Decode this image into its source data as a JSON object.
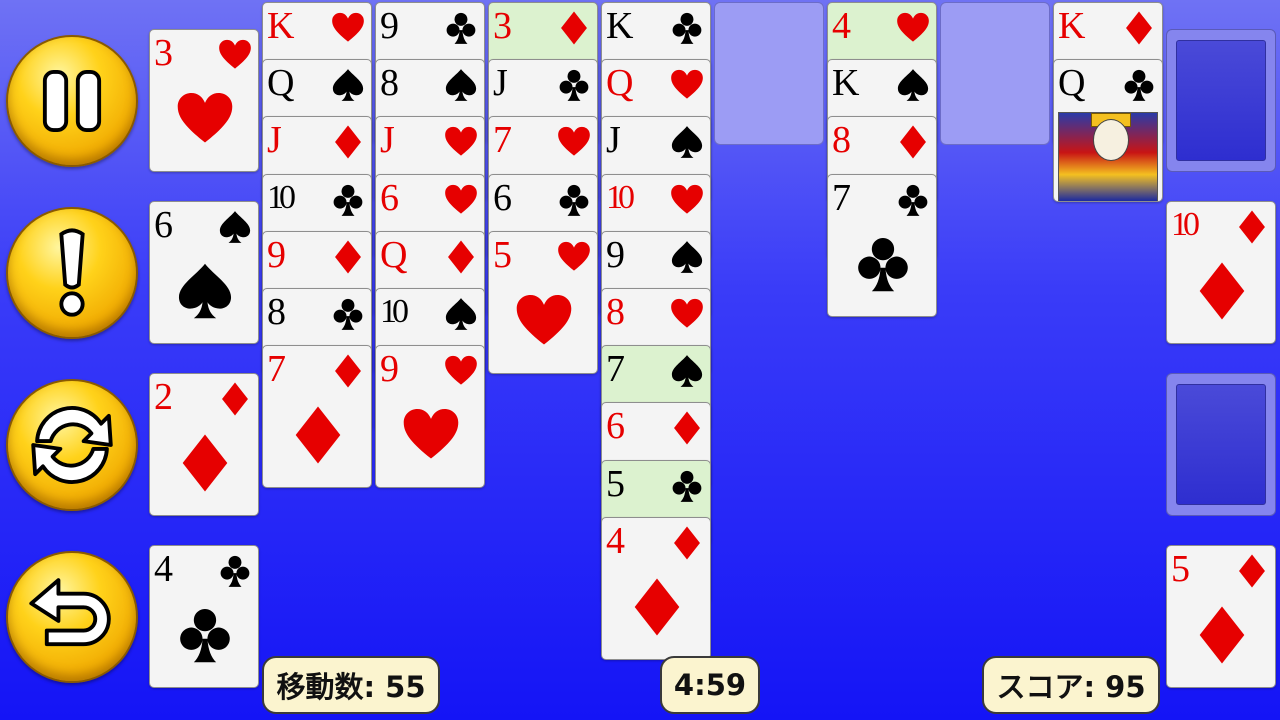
{
  "status": {
    "moves_label": "移動数: 55",
    "timer": "4:59",
    "score_label": "スコア: 95"
  },
  "controls": [
    {
      "name": "pause-button",
      "icon": "pause-icon"
    },
    {
      "name": "hint-button",
      "icon": "exclamation-icon"
    },
    {
      "name": "shuffle-button",
      "icon": "refresh-icon"
    },
    {
      "name": "undo-button",
      "icon": "undo-icon"
    }
  ],
  "free_cells": [
    {
      "rank": "3",
      "suit": "hearts"
    },
    {
      "rank": "6",
      "suit": "spades"
    },
    {
      "rank": "2",
      "suit": "diamonds"
    },
    {
      "rank": "4",
      "suit": "clubs"
    }
  ],
  "columns": [
    [
      {
        "rank": "K",
        "suit": "hearts"
      },
      {
        "rank": "Q",
        "suit": "spades"
      },
      {
        "rank": "J",
        "suit": "diamonds"
      },
      {
        "rank": "10",
        "suit": "clubs"
      },
      {
        "rank": "9",
        "suit": "diamonds"
      },
      {
        "rank": "8",
        "suit": "clubs"
      },
      {
        "rank": "7",
        "suit": "diamonds"
      }
    ],
    [
      {
        "rank": "9",
        "suit": "clubs"
      },
      {
        "rank": "8",
        "suit": "spades"
      },
      {
        "rank": "J",
        "suit": "hearts"
      },
      {
        "rank": "6",
        "suit": "hearts"
      },
      {
        "rank": "Q",
        "suit": "diamonds"
      },
      {
        "rank": "10",
        "suit": "spades"
      },
      {
        "rank": "9",
        "suit": "hearts"
      }
    ],
    [
      {
        "rank": "3",
        "suit": "diamonds",
        "highlight": true
      },
      {
        "rank": "J",
        "suit": "clubs"
      },
      {
        "rank": "7",
        "suit": "hearts"
      },
      {
        "rank": "6",
        "suit": "clubs"
      },
      {
        "rank": "5",
        "suit": "hearts"
      }
    ],
    [
      {
        "rank": "K",
        "suit": "clubs"
      },
      {
        "rank": "Q",
        "suit": "hearts"
      },
      {
        "rank": "J",
        "suit": "spades"
      },
      {
        "rank": "10",
        "suit": "hearts"
      },
      {
        "rank": "9",
        "suit": "spades"
      },
      {
        "rank": "8",
        "suit": "hearts"
      },
      {
        "rank": "7",
        "suit": "spades",
        "highlight": true
      },
      {
        "rank": "6",
        "suit": "diamonds"
      },
      {
        "rank": "5",
        "suit": "clubs",
        "highlight": true
      },
      {
        "rank": "4",
        "suit": "diamonds"
      }
    ],
    [],
    [
      {
        "rank": "4",
        "suit": "hearts",
        "highlight": true
      },
      {
        "rank": "K",
        "suit": "spades"
      },
      {
        "rank": "8",
        "suit": "diamonds"
      },
      {
        "rank": "7",
        "suit": "clubs"
      }
    ],
    [],
    [
      {
        "rank": "K",
        "suit": "diamonds"
      },
      {
        "rank": "Q",
        "suit": "clubs",
        "face": true
      }
    ]
  ],
  "right_piles": [
    {
      "type": "back"
    },
    {
      "type": "card",
      "rank": "10",
      "suit": "diamonds"
    },
    {
      "type": "back"
    },
    {
      "type": "card",
      "rank": "5",
      "suit": "diamonds"
    }
  ],
  "colors": {
    "red_suit": "#e60000",
    "black_suit": "#000000",
    "highlight": "#dcf2cf",
    "button_gold": "#ffd21a",
    "background": "#1414f6"
  }
}
